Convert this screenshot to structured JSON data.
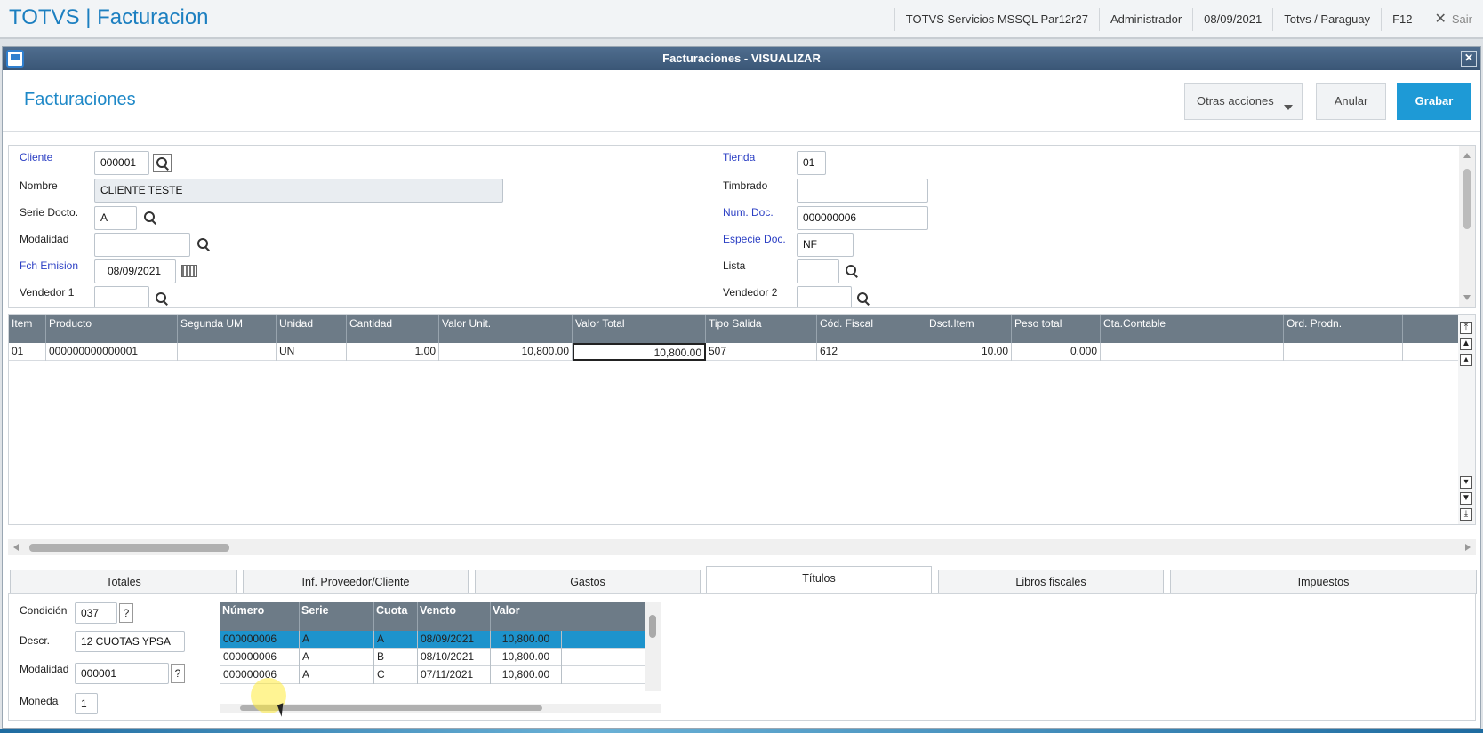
{
  "topbar": {
    "app_title": "TOTVS | Facturacion",
    "environment": "TOTVS Servicios MSSQL Par12r27",
    "user": "Administrador",
    "date": "08/09/2021",
    "company": "Totvs / Paraguay",
    "help_key": "F12",
    "exit_label": "Sair"
  },
  "window": {
    "title": "Facturaciones - VISUALIZAR"
  },
  "header": {
    "page_title": "Facturaciones",
    "other_actions_label": "Otras acciones",
    "cancel_label": "Anular",
    "save_label": "Grabar"
  },
  "form": {
    "cliente_label": "Cliente",
    "cliente_value": "000001",
    "nombre_label": "Nombre",
    "nombre_value": "CLIENTE TESTE",
    "serie_label": "Serie Docto.",
    "serie_value": "A",
    "modalidad_label": "Modalidad",
    "modalidad_value": "",
    "fch_emision_label": "Fch Emision",
    "fch_emision_value": "08/09/2021",
    "vendedor1_label": "Vendedor 1",
    "vendedor1_value": "",
    "tienda_label": "Tienda",
    "tienda_value": "01",
    "timbrado_label": "Timbrado",
    "timbrado_value": "",
    "num_doc_label": "Num. Doc.",
    "num_doc_value": "000000006",
    "especie_label": "Especie Doc.",
    "especie_value": "NF",
    "lista_label": "Lista",
    "lista_value": "",
    "vendedor2_label": "Vendedor 2",
    "vendedor2_value": ""
  },
  "items_grid": {
    "headers": [
      "Item",
      "Producto",
      "Segunda UM",
      "Unidad",
      "Cantidad",
      "Valor Unit.",
      "Valor Total",
      "Tipo Salida",
      "Cód. Fiscal",
      "Dsct.Item",
      "Peso total",
      "Cta.Contable",
      "Ord. Prodn."
    ],
    "rows": [
      [
        "01",
        "000000000000001",
        "",
        "UN",
        "1.00",
        "10,800.00",
        "10,800.00",
        "507",
        "612",
        "10.00",
        "0.000",
        "",
        ""
      ]
    ]
  },
  "tabs": [
    "Totales",
    "Inf. Proveedor/Cliente",
    "Gastos",
    "Títulos",
    "Libros fiscales",
    "Impuestos"
  ],
  "titulos": {
    "condicion_label": "Condición",
    "condicion_value": "037",
    "descr_label": "Descr.",
    "descr_value": "12 CUOTAS YPSA",
    "modalidad_label": "Modalidad",
    "modalidad_value": "000001",
    "moneda_label": "Moneda",
    "moneda_value": "1",
    "help_mark": "?",
    "headers": [
      "Número",
      "Serie",
      "Cuota",
      "Vencto",
      "Valor"
    ],
    "rows": [
      [
        "000000006",
        "A",
        "A",
        "08/09/2021",
        "10,800.00"
      ],
      [
        "000000006",
        "A",
        "B",
        "08/10/2021",
        "10,800.00"
      ],
      [
        "000000006",
        "A",
        "C",
        "07/11/2021",
        "10,800.00"
      ]
    ]
  }
}
